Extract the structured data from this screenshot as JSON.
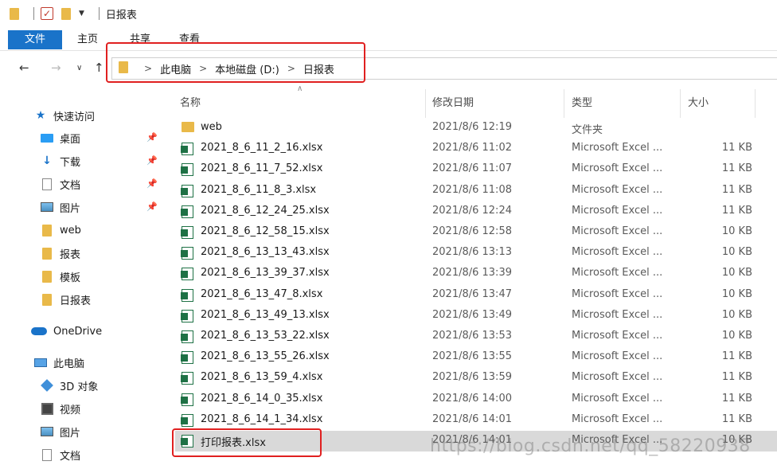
{
  "window": {
    "title": "日报表"
  },
  "ribbon": {
    "tabs": [
      {
        "label": "文件"
      },
      {
        "label": "主页"
      },
      {
        "label": "共享"
      },
      {
        "label": "查看"
      }
    ]
  },
  "address": {
    "crumbs": [
      "此电脑",
      "本地磁盘 (D:)",
      "日报表"
    ]
  },
  "sidebar": {
    "items": [
      {
        "label": "快速访问",
        "icon": "star-icon"
      },
      {
        "label": "桌面",
        "icon": "desktop-icon",
        "pinned": true
      },
      {
        "label": "下载",
        "icon": "download-icon",
        "pinned": true
      },
      {
        "label": "文档",
        "icon": "document-icon",
        "pinned": true
      },
      {
        "label": "图片",
        "icon": "picture-icon",
        "pinned": true
      },
      {
        "label": "web",
        "icon": "folder-icon"
      },
      {
        "label": "报表",
        "icon": "folder-icon"
      },
      {
        "label": "模板",
        "icon": "folder-icon"
      },
      {
        "label": "日报表",
        "icon": "folder-icon"
      },
      {
        "label": "OneDrive",
        "icon": "cloud-icon"
      },
      {
        "label": "此电脑",
        "icon": "computer-icon"
      },
      {
        "label": "3D 对象",
        "icon": "3d-objects-icon"
      },
      {
        "label": "视频",
        "icon": "video-icon"
      },
      {
        "label": "图片",
        "icon": "picture-icon"
      },
      {
        "label": "文档",
        "icon": "document-icon"
      }
    ]
  },
  "columns": {
    "name": "名称",
    "modified": "修改日期",
    "type": "类型",
    "size": "大小"
  },
  "files": [
    {
      "name": "web",
      "modified": "2021/8/6 12:19",
      "type": "文件夹",
      "size": "",
      "icon": "folder-icon"
    },
    {
      "name": "2021_8_6_11_2_16.xlsx",
      "modified": "2021/8/6 11:02",
      "type": "Microsoft Excel ...",
      "size": "11 KB",
      "icon": "excel-file-icon"
    },
    {
      "name": "2021_8_6_11_7_52.xlsx",
      "modified": "2021/8/6 11:07",
      "type": "Microsoft Excel ...",
      "size": "11 KB",
      "icon": "excel-file-icon"
    },
    {
      "name": "2021_8_6_11_8_3.xlsx",
      "modified": "2021/8/6 11:08",
      "type": "Microsoft Excel ...",
      "size": "11 KB",
      "icon": "excel-file-icon"
    },
    {
      "name": "2021_8_6_12_24_25.xlsx",
      "modified": "2021/8/6 12:24",
      "type": "Microsoft Excel ...",
      "size": "11 KB",
      "icon": "excel-file-icon"
    },
    {
      "name": "2021_8_6_12_58_15.xlsx",
      "modified": "2021/8/6 12:58",
      "type": "Microsoft Excel ...",
      "size": "10 KB",
      "icon": "excel-file-icon"
    },
    {
      "name": "2021_8_6_13_13_43.xlsx",
      "modified": "2021/8/6 13:13",
      "type": "Microsoft Excel ...",
      "size": "10 KB",
      "icon": "excel-file-icon"
    },
    {
      "name": "2021_8_6_13_39_37.xlsx",
      "modified": "2021/8/6 13:39",
      "type": "Microsoft Excel ...",
      "size": "10 KB",
      "icon": "excel-file-icon"
    },
    {
      "name": "2021_8_6_13_47_8.xlsx",
      "modified": "2021/8/6 13:47",
      "type": "Microsoft Excel ...",
      "size": "10 KB",
      "icon": "excel-file-icon"
    },
    {
      "name": "2021_8_6_13_49_13.xlsx",
      "modified": "2021/8/6 13:49",
      "type": "Microsoft Excel ...",
      "size": "10 KB",
      "icon": "excel-file-icon"
    },
    {
      "name": "2021_8_6_13_53_22.xlsx",
      "modified": "2021/8/6 13:53",
      "type": "Microsoft Excel ...",
      "size": "10 KB",
      "icon": "excel-file-icon"
    },
    {
      "name": "2021_8_6_13_55_26.xlsx",
      "modified": "2021/8/6 13:55",
      "type": "Microsoft Excel ...",
      "size": "11 KB",
      "icon": "excel-file-icon"
    },
    {
      "name": "2021_8_6_13_59_4.xlsx",
      "modified": "2021/8/6 13:59",
      "type": "Microsoft Excel ...",
      "size": "11 KB",
      "icon": "excel-file-icon"
    },
    {
      "name": "2021_8_6_14_0_35.xlsx",
      "modified": "2021/8/6 14:00",
      "type": "Microsoft Excel ...",
      "size": "11 KB",
      "icon": "excel-file-icon"
    },
    {
      "name": "2021_8_6_14_1_34.xlsx",
      "modified": "2021/8/6 14:01",
      "type": "Microsoft Excel ...",
      "size": "11 KB",
      "icon": "excel-file-icon"
    },
    {
      "name": "打印报表.xlsx",
      "modified": "2021/8/6 14:01",
      "type": "Microsoft Excel ...",
      "size": "10 KB",
      "icon": "excel-file-icon",
      "selected": true
    }
  ],
  "watermark": "https://blog.csdn.net/qq_58220938",
  "colors": {
    "accent": "#1a73c9",
    "highlight_box": "#e02020",
    "folder": "#e9b949",
    "excel": "#1e7145",
    "selected_row": "#d9d9d9"
  }
}
